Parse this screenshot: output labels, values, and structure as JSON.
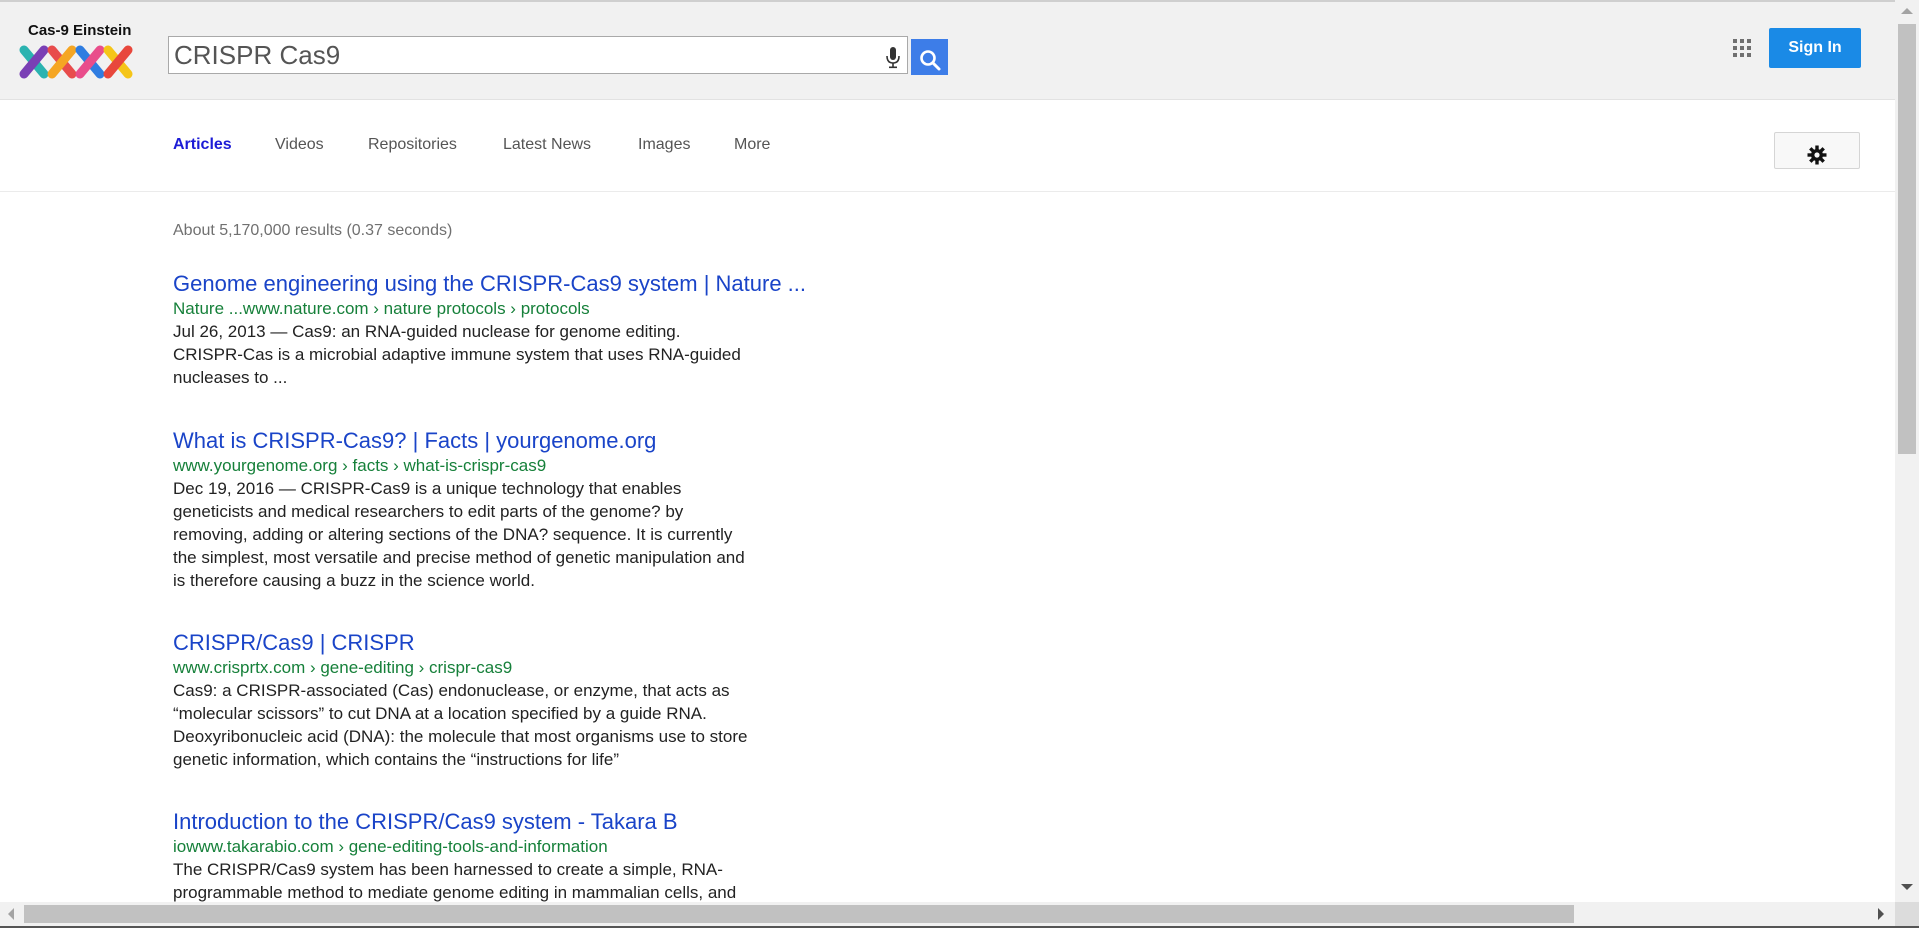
{
  "header": {
    "logo_text": "Cas-9 Einstein",
    "logo_icon": "dna-helix-logo",
    "search": {
      "value": "CRISPR Cas9",
      "mic_icon": "microphone-icon",
      "button_icon": "search-icon"
    },
    "apps_icon": "grid-apps-icon",
    "signin_label": "Sign In"
  },
  "nav": {
    "tabs": [
      {
        "label": "Articles",
        "active": true
      },
      {
        "label": "Videos",
        "active": false
      },
      {
        "label": "Repositories",
        "active": false
      },
      {
        "label": "Latest News",
        "active": false
      },
      {
        "label": "Images",
        "active": false
      },
      {
        "label": "More",
        "active": false
      }
    ],
    "settings_icon": "gear-icon"
  },
  "results": {
    "stats": "About 5,170,000 results (0.37 seconds)",
    "items": [
      {
        "title": "Genome engineering using the CRISPR-Cas9 system | Nature ...",
        "url": "Nature ...www.nature.com › nature protocols › protocols",
        "snippet": [
          "Jul 26, 2013 — Cas9: an RNA-guided nuclease for genome editing.",
          "CRISPR-Cas is a microbial adaptive immune system that uses RNA-guided",
          "nucleases to ..."
        ]
      },
      {
        "title": "What is CRISPR-Cas9? | Facts | yourgenome.org",
        "url": "www.yourgenome.org › facts › what-is-crispr-cas9",
        "snippet": [
          "Dec 19, 2016 — CRISPR-Cas9 is a unique technology that enables",
          "geneticists and medical researchers to edit parts of the genome? by",
          "removing, adding or altering sections of the DNA? sequence. It is currently",
          "the simplest, most versatile and precise method of genetic manipulation and",
          "is therefore causing a buzz in the science world."
        ]
      },
      {
        "title": "CRISPR/Cas9 | CRISPR",
        "url": "www.crisprtx.com › gene-editing › crispr-cas9",
        "snippet": [
          "Cas9: a CRISPR-associated (Cas) endonuclease, or enzyme, that acts as",
          "“molecular scissors” to cut DNA at a location specified by a guide RNA.",
          "Deoxyribonucleic acid (DNA): the molecule that most organisms use to store",
          "genetic information, which contains the “instructions for life”"
        ]
      },
      {
        "title": "Introduction to the CRISPR/Cas9 system - Takara B",
        "url": "iowww.takarabio.com › gene-editing-tools-and-information",
        "snippet": [
          "The CRISPR/Cas9 system has been harnessed to create a simple, RNA-",
          "programmable method to mediate genome editing in mammalian cells, and"
        ]
      }
    ]
  }
}
